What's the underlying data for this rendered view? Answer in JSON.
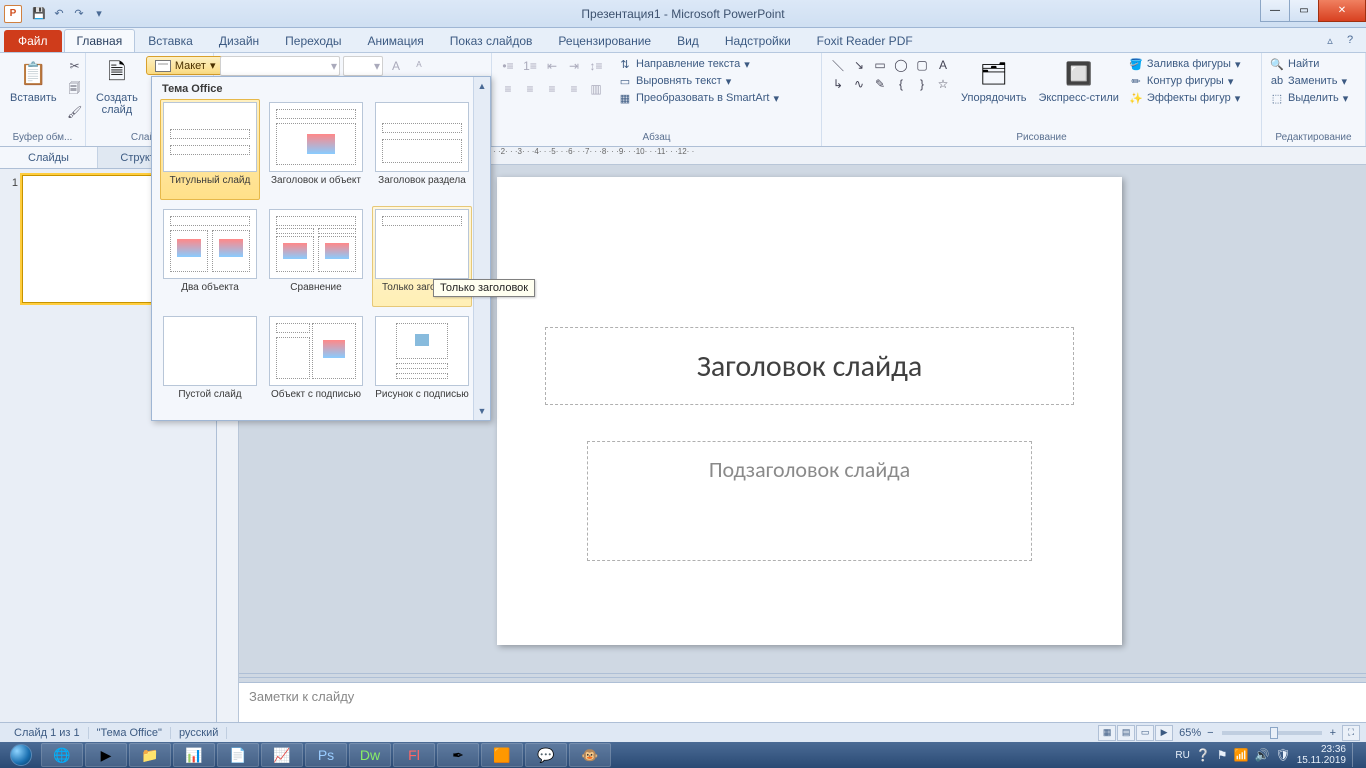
{
  "window": {
    "title": "Презентация1 - Microsoft PowerPoint",
    "app_letter": "P"
  },
  "qat": {
    "save": "💾",
    "undo": "↶",
    "redo": "↷",
    "more": "▾"
  },
  "tabs": {
    "file": "Файл",
    "items": [
      "Главная",
      "Вставка",
      "Дизайн",
      "Переходы",
      "Анимация",
      "Показ слайдов",
      "Рецензирование",
      "Вид",
      "Надстройки",
      "Foxit Reader PDF"
    ],
    "active_index": 0
  },
  "ribbon_help": {
    "min": "▵",
    "help": "?"
  },
  "ribbon": {
    "clipboard": {
      "paste": "Вставить",
      "group": "Буфер обм..."
    },
    "slides": {
      "new": "Создать слайд",
      "layout": "Макет",
      "group": "Слайды"
    },
    "paragraph": {
      "group": "Абзац",
      "text_dir": "Направление текста",
      "align_text": "Выровнять текст",
      "smartart": "Преобразовать в SmartArt"
    },
    "drawing": {
      "arrange": "Упорядочить",
      "quick_styles": "Экспресс-стили",
      "fill": "Заливка фигуры",
      "outline": "Контур фигуры",
      "effects": "Эффекты фигур",
      "group": "Рисование"
    },
    "editing": {
      "find": "Найти",
      "replace": "Заменить",
      "select": "Выделить",
      "group": "Редактирование"
    }
  },
  "ruler": "· · ·12· · ·11· · ·10· · ·9· · ·8· · ·7· · ·6· · ·5· · ·4· · ·3· · ·2· · ·1· · ·0· · ·1· · ·2· · ·3· · ·4· · ·5· · ·6· · ·7· · ·8· · ·9· · ·10· · ·11· · ·12· ·",
  "gallery": {
    "header": "Тема Office",
    "tooltip": "Только заголовок",
    "items": [
      {
        "label": "Титульный слайд",
        "kind": "title"
      },
      {
        "label": "Заголовок и объект",
        "kind": "title-content"
      },
      {
        "label": "Заголовок раздела",
        "kind": "section"
      },
      {
        "label": "Два объекта",
        "kind": "two"
      },
      {
        "label": "Сравнение",
        "kind": "compare"
      },
      {
        "label": "Только заголовок",
        "kind": "title-only"
      },
      {
        "label": "Пустой слайд",
        "kind": "blank"
      },
      {
        "label": "Объект с подписью",
        "kind": "obj-caption"
      },
      {
        "label": "Рисунок с подписью",
        "kind": "pic-caption"
      }
    ],
    "selected": 0,
    "hover": 5
  },
  "left_pane": {
    "tabs": [
      "Слайды",
      "Структура"
    ],
    "active": 0,
    "slide_number": "1"
  },
  "slide": {
    "title_ph": "Заголовок слайда",
    "subtitle_ph": "Подзаголовок слайда"
  },
  "notes": {
    "placeholder": "Заметки к слайду"
  },
  "status": {
    "slide_count": "Слайд 1 из 1",
    "theme": "\"Тема Office\"",
    "lang": "русский",
    "zoom": "65%",
    "zoom_minus": "−",
    "zoom_plus": "+"
  },
  "taskbar": {
    "items": [
      "🌐",
      "▶",
      "📁",
      "📊",
      "📄",
      "📈",
      "Ps",
      "Dw",
      "Fl",
      "✒",
      "🟧",
      "💬",
      "🐵"
    ],
    "tray_lang": "RU",
    "time": "23:36",
    "date": "15.11.2019"
  }
}
